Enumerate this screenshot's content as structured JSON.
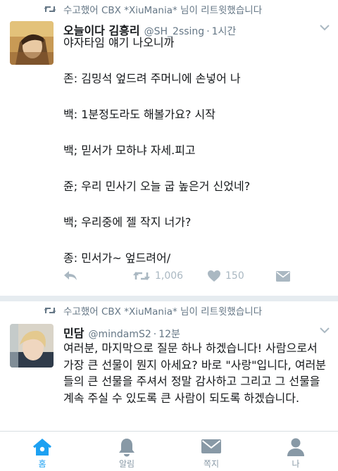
{
  "colors": {
    "accent": "#1da1f2",
    "text": "#14171a",
    "muted": "#657786",
    "icon_grey": "#aab8c2",
    "divider": "#e6ecf0"
  },
  "tweets": [
    {
      "retweet_notice": "수고했어 CBX *XiuMania* 님이 리트윗했습니다",
      "name": "오늘이다 김흥리",
      "handle": "@SH_2ssing",
      "separator": "·",
      "time": "1시간",
      "lines": [
        "야자타임 얘기 나오니까",
        "",
        "존: 김밍석 엎드려 주머니에 손넣어 나",
        "",
        "백: 1분정도라도 해볼가요? 시작",
        "",
        "백; 믿서가 모하냐 자세.피고",
        "",
        "쥰; 우리 민사기 오늘 굽 높은거 신었네?",
        "",
        "백; 우리중에 젤 작지 너가?",
        "",
        "종: 민서가~ 엎드려어/"
      ],
      "retweet_count": "1,006",
      "like_count": "150",
      "avatar_icon": "avatar-photo-icon"
    },
    {
      "retweet_notice": "수고했어 CBX *XiuMania* 님이 리트윗했습니다",
      "name": "민담",
      "handle": "@mindamS2",
      "separator": "·",
      "time": "12분",
      "text": "여러분, 마지막으로 질문 하나 하겠습니다! 사람으로서 가장 큰 선물이 뭔지 아세요? 바로 \"사랑\"입니다, 여러분들의 큰 선물을 주셔서 정말 감사하고 그리고 그 선물을 계속 주실 수 있도록 큰 사람이 되도록 하겠습니다.",
      "avatar_icon": "avatar-photo-icon"
    }
  ],
  "tabbar": [
    {
      "label": "홈",
      "icon": "home-icon",
      "active": true
    },
    {
      "label": "알림",
      "icon": "bell-icon",
      "active": false
    },
    {
      "label": "쪽지",
      "icon": "envelope-icon",
      "active": false
    },
    {
      "label": "나",
      "icon": "person-icon",
      "active": false
    }
  ]
}
